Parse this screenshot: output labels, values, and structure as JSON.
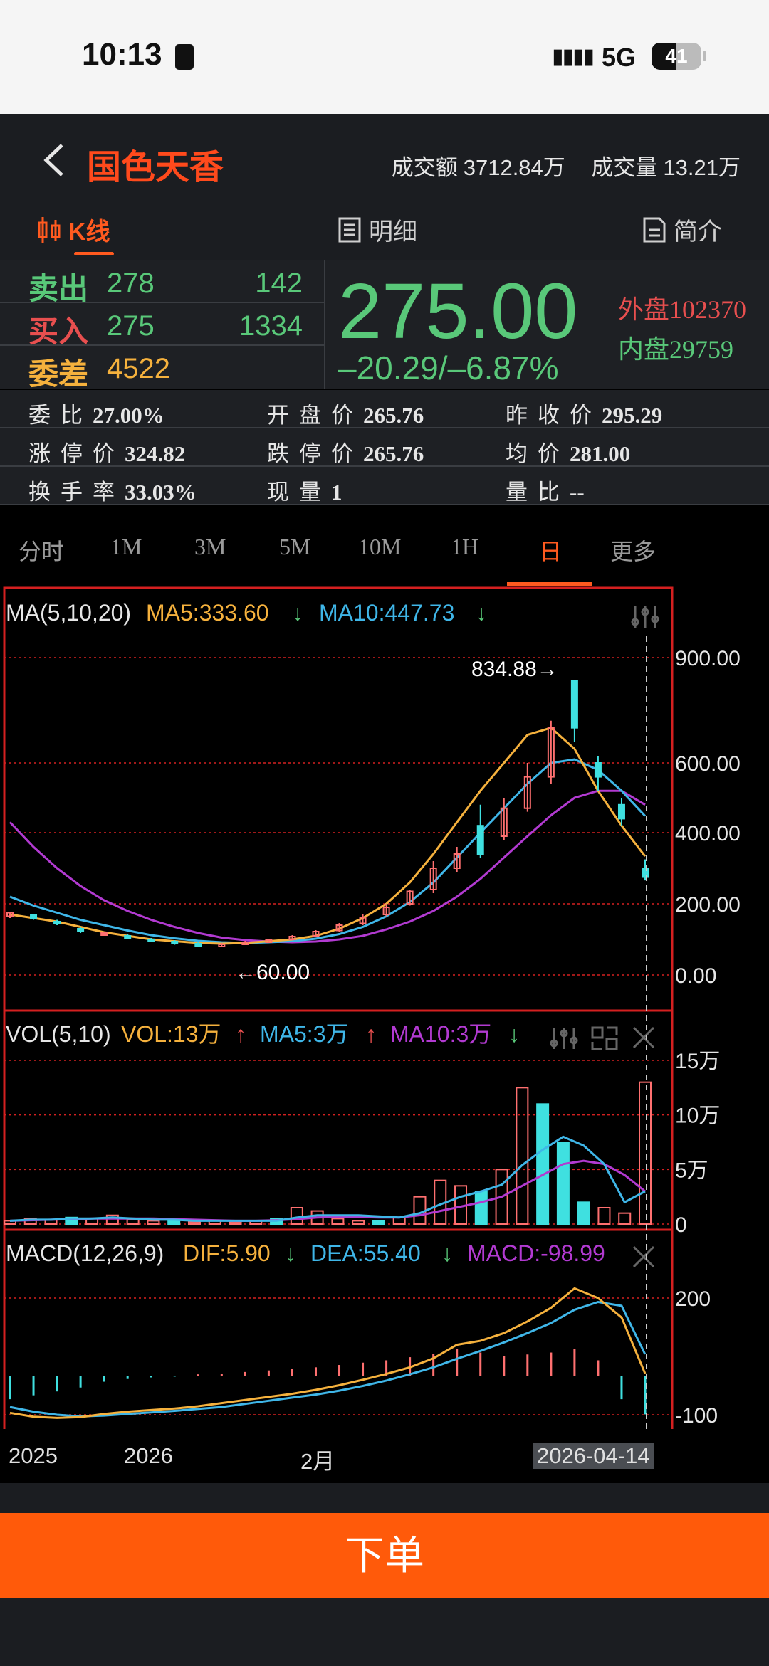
{
  "status_bar": {
    "time": "10:13",
    "network": "5G",
    "battery": "41"
  },
  "header": {
    "title": "国色天香",
    "turnover_label": "成交额",
    "turnover_value": "3712.84万",
    "volume_label": "成交量",
    "volume_value": "13.21万"
  },
  "view_tabs": [
    {
      "label": "K线",
      "icon": "candlestick-icon",
      "active": true
    },
    {
      "label": "明细",
      "icon": "list-icon"
    },
    {
      "label": "简介",
      "icon": "document-icon"
    }
  ],
  "quote": {
    "sell_label": "卖出",
    "sell_price": "278",
    "sell_volume": "142",
    "buy_label": "买入",
    "buy_price": "275",
    "buy_volume": "1334",
    "diff_label": "委差",
    "diff_value": "4522",
    "price": "275.00",
    "change": "–20.29/–6.87%",
    "outer_label": "外盘",
    "outer_value": "102370",
    "inner_label": "内盘",
    "inner_value": "29759"
  },
  "stats": [
    [
      {
        "label": "委比",
        "value": "27.00%"
      },
      {
        "label": "开盘价",
        "value": "265.76"
      },
      {
        "label": "昨收价",
        "value": "295.29"
      }
    ],
    [
      {
        "label": "涨停价",
        "value": "324.82"
      },
      {
        "label": "跌停价",
        "value": "265.76"
      },
      {
        "label": "均价",
        "value": "281.00"
      }
    ],
    [
      {
        "label": "换手率",
        "value": "33.03%"
      },
      {
        "label": "现量",
        "value": "1"
      },
      {
        "label": "量比",
        "value": "--"
      }
    ]
  ],
  "periods": [
    "分时",
    "1M",
    "3M",
    "5M",
    "10M",
    "1H",
    "日",
    "更多"
  ],
  "active_period": "日",
  "colors": {
    "accent": "#ff5a1f",
    "down": "#59c879",
    "up": "#e84f4f",
    "ma5": "#f5b13d",
    "ma10": "#3fb6e8",
    "ma20": "#b23ad1",
    "grid": "#d42020"
  },
  "chart_data": {
    "type": "line",
    "main": {
      "indicator": "MA(5,10,20)",
      "ma5_label": "MA5:333.60",
      "ma5_arrow": "↓",
      "ma10_label": "MA10:447.73",
      "ma10_arrow": "↓",
      "y_ticks": [
        "900.00",
        "600.00",
        "400.00",
        "200.00",
        "0.00"
      ],
      "high_label": "834.88→",
      "low_label": "←60.00",
      "ylim": [
        0,
        900
      ],
      "ma5": [
        170,
        160,
        150,
        135,
        120,
        110,
        100,
        95,
        90,
        88,
        90,
        95,
        100,
        110,
        130,
        160,
        200,
        260,
        340,
        430,
        520,
        600,
        680,
        700,
        640,
        520,
        420,
        333.6
      ],
      "ma10": [
        220,
        195,
        175,
        155,
        140,
        125,
        112,
        103,
        96,
        92,
        90,
        92,
        95,
        102,
        115,
        135,
        165,
        205,
        260,
        330,
        400,
        470,
        540,
        600,
        610,
        580,
        520,
        447.73
      ],
      "ma20": [
        430,
        360,
        300,
        250,
        210,
        180,
        155,
        135,
        118,
        105,
        98,
        94,
        92,
        94,
        100,
        110,
        128,
        150,
        180,
        220,
        270,
        330,
        390,
        450,
        500,
        520,
        520,
        480
      ],
      "candles": [
        [
          165,
          175,
          160,
          178,
          0
        ],
        [
          160,
          168,
          155,
          172,
          1
        ],
        [
          150,
          145,
          140,
          155,
          1
        ],
        [
          130,
          125,
          118,
          135,
          1
        ],
        [
          115,
          118,
          110,
          122,
          0
        ],
        [
          110,
          106,
          102,
          114,
          1
        ],
        [
          100,
          96,
          92,
          104,
          1
        ],
        [
          94,
          90,
          85,
          98,
          1
        ],
        [
          88,
          84,
          80,
          92,
          1
        ],
        [
          84,
          86,
          80,
          90,
          0
        ],
        [
          86,
          92,
          84,
          96,
          0
        ],
        [
          92,
          98,
          90,
          102,
          0
        ],
        [
          100,
          108,
          98,
          112,
          0
        ],
        [
          110,
          122,
          108,
          126,
          0
        ],
        [
          125,
          140,
          122,
          146,
          0
        ],
        [
          145,
          162,
          140,
          170,
          0
        ],
        [
          170,
          190,
          165,
          200,
          0
        ],
        [
          200,
          235,
          195,
          240,
          0
        ],
        [
          240,
          300,
          230,
          320,
          0
        ],
        [
          300,
          340,
          290,
          360,
          0
        ],
        [
          340,
          420,
          330,
          480,
          1
        ],
        [
          390,
          470,
          380,
          500,
          0
        ],
        [
          470,
          560,
          460,
          600,
          0
        ],
        [
          560,
          700,
          540,
          720,
          0
        ],
        [
          700,
          834.88,
          660,
          834.88,
          1
        ],
        [
          600,
          560,
          520,
          620,
          1
        ],
        [
          480,
          440,
          420,
          500,
          1
        ],
        [
          300,
          275,
          265.76,
          324.82,
          1
        ]
      ]
    },
    "volume": {
      "indicator": "VOL(5,10)",
      "vol_label": "VOL:13万",
      "ma5_label": "MA5:3万",
      "ma10_label": "MA10:3万",
      "y_ticks": [
        "15万",
        "10万",
        "5万",
        "0"
      ],
      "ylim": [
        0,
        15
      ],
      "values": [
        0.3,
        0.5,
        0.4,
        0.6,
        0.5,
        0.8,
        0.4,
        0.3,
        0.3,
        0.2,
        0.3,
        0.2,
        0.3,
        0.5,
        1.5,
        1.2,
        0.5,
        0.3,
        0.3,
        0.6,
        2.5,
        4.0,
        3.5,
        3.0,
        5.0,
        12.5,
        11.0,
        7.5,
        2.0,
        1.5,
        1.0,
        13.0
      ],
      "ma5": [
        0.3,
        0.4,
        0.4,
        0.5,
        0.5,
        0.6,
        0.5,
        0.4,
        0.4,
        0.3,
        0.3,
        0.3,
        0.3,
        0.3,
        0.6,
        0.8,
        0.8,
        0.8,
        0.7,
        0.6,
        1.0,
        1.8,
        2.5,
        3.0,
        3.6,
        5.4,
        6.8,
        8.0,
        7.2,
        5.5,
        2.0,
        3.0
      ],
      "ma10": [
        0.3,
        0.35,
        0.4,
        0.45,
        0.5,
        0.5,
        0.5,
        0.5,
        0.45,
        0.4,
        0.35,
        0.3,
        0.3,
        0.35,
        0.45,
        0.6,
        0.65,
        0.65,
        0.6,
        0.6,
        0.8,
        1.2,
        1.6,
        2.0,
        2.5,
        3.5,
        4.5,
        5.5,
        5.8,
        5.5,
        4.5,
        3.0
      ]
    },
    "macd": {
      "indicator": "MACD(12,26,9)",
      "dif_label": "DIF:5.90",
      "dea_label": "DEA:55.40",
      "macd_label": "MACD:-98.99",
      "y_ticks": [
        "200",
        "-100"
      ],
      "ylim": [
        -120,
        240
      ],
      "dif": [
        -95,
        -105,
        -108,
        -106,
        -98,
        -92,
        -88,
        -84,
        -78,
        -70,
        -62,
        -54,
        -46,
        -36,
        -24,
        -10,
        5,
        22,
        45,
        80,
        90,
        110,
        140,
        175,
        225,
        200,
        150,
        5.9
      ],
      "dea": [
        -80,
        -92,
        -100,
        -104,
        -102,
        -98,
        -94,
        -90,
        -85,
        -80,
        -72,
        -64,
        -56,
        -48,
        -38,
        -26,
        -12,
        4,
        22,
        44,
        64,
        86,
        110,
        136,
        170,
        190,
        180,
        55.4
      ],
      "hist": [
        -60,
        -50,
        -40,
        -30,
        -15,
        -8,
        -4,
        -2,
        4,
        6,
        10,
        14,
        18,
        22,
        28,
        34,
        40,
        48,
        56,
        70,
        60,
        50,
        55,
        60,
        70,
        40,
        -60,
        -98.99
      ]
    },
    "x_labels": [
      "2025",
      "2026",
      "2月",
      "2026-04-14"
    ]
  }
}
